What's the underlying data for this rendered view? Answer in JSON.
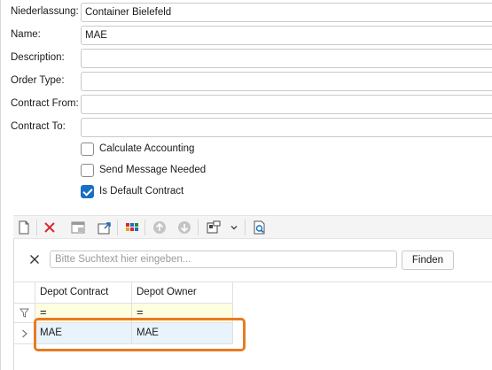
{
  "form": {
    "niederlassung": {
      "label": "Niederlassung:",
      "value": "Container Bielefeld"
    },
    "name": {
      "label": "Name:",
      "value": "MAE"
    },
    "description": {
      "label": "Description:",
      "value": ""
    },
    "order_type": {
      "label": "Order Type:",
      "value": ""
    },
    "contract_from": {
      "label": "Contract From:",
      "value": ""
    },
    "contract_to": {
      "label": "Contract To:",
      "value": ""
    },
    "checks": [
      {
        "label": "Calculate Accounting",
        "checked": false
      },
      {
        "label": "Send Message Needed",
        "checked": false
      },
      {
        "label": "Is Default Contract",
        "checked": true
      }
    ]
  },
  "toolbar": {
    "icons": [
      "new-icon",
      "delete-icon",
      "window-icon",
      "export-icon",
      "grid-icon",
      "up-icon",
      "down-icon",
      "layout-icon",
      "dropdown-icon",
      "preview-icon"
    ]
  },
  "search": {
    "placeholder": "Bitte Suchtext hier eingeben...",
    "value": "",
    "button_label": "Finden"
  },
  "grid": {
    "columns": [
      "Depot Contract",
      "Depot Owner"
    ],
    "filter_symbols": [
      "=",
      "="
    ],
    "rows": [
      [
        "MAE",
        "MAE"
      ]
    ]
  },
  "colors": {
    "accent": "#1a6fc4",
    "highlight": "#e87b22",
    "filter_row": "#fffde0",
    "selected_row": "#e8f3fc"
  }
}
